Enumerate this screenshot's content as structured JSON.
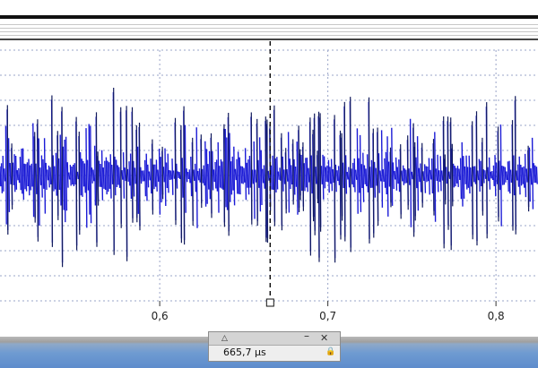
{
  "chart_data": {
    "type": "line",
    "x_ticks": [
      "0,6",
      "0,7",
      "0,8"
    ],
    "x_tick_values": [
      0.6,
      0.7,
      0.8
    ],
    "x_range": [
      0.505,
      0.825
    ],
    "series": [
      {
        "color": "#1c1cd6",
        "style": "dense noise signal centered on zero"
      }
    ],
    "cursor_x": 0.6657,
    "grid": true
  },
  "cursor_readout": {
    "value": "665,7 µs",
    "sort_icon": "△",
    "minimize_icon": "–",
    "close_icon": "✕",
    "lock_icon": "🔒"
  },
  "colors": {
    "signal": "#1c1cd6",
    "signal_dark": "#111a5c",
    "grid": "#9aa4c8",
    "cursor": "#111111",
    "taskbar": "#5e8ccc"
  }
}
